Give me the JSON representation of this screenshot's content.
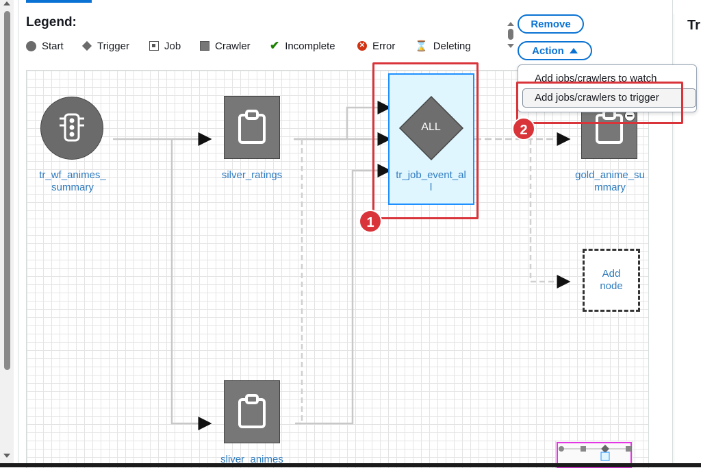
{
  "legend": {
    "title": "Legend:",
    "items": {
      "start": "Start",
      "trigger": "Trigger",
      "job": "Job",
      "crawler": "Crawler",
      "incomplete": "Incomplete",
      "error": "Error",
      "deleting": "Deleting"
    }
  },
  "toolbar": {
    "remove_label": "Remove",
    "action_label": "Action"
  },
  "action_menu": {
    "items": [
      "Add jobs/crawlers to watch",
      "Add jobs/crawlers to trigger"
    ]
  },
  "right_panel": {
    "title": "Tr"
  },
  "graph": {
    "nodes": {
      "start_trigger": {
        "label_line1": "tr_wf_animes_",
        "label_line2": "summary"
      },
      "silver_ratings": {
        "label": "silver_ratings"
      },
      "trigger_all": {
        "badge": "ALL",
        "label_line1": "tr_job_event_al",
        "label_line2": "l"
      },
      "gold_anime_summary": {
        "label_line1": "gold_anime_su",
        "label_line2": "mmary"
      },
      "add_node": {
        "label_line1": "Add",
        "label_line2": "node"
      },
      "sliver_animes": {
        "label": "sliver_animes"
      }
    }
  },
  "callouts": {
    "first": "1",
    "second": "2"
  },
  "colors": {
    "accent": "#0972d3",
    "callout": "#d9343a",
    "selected_fill": "#dff6ff",
    "selected_border": "#0972d3",
    "minimap_border": "#e535e5"
  },
  "icons": {
    "start": "traffic-light-icon",
    "job": "clipboard-icon",
    "remove_badge": "minus-circle-icon"
  }
}
